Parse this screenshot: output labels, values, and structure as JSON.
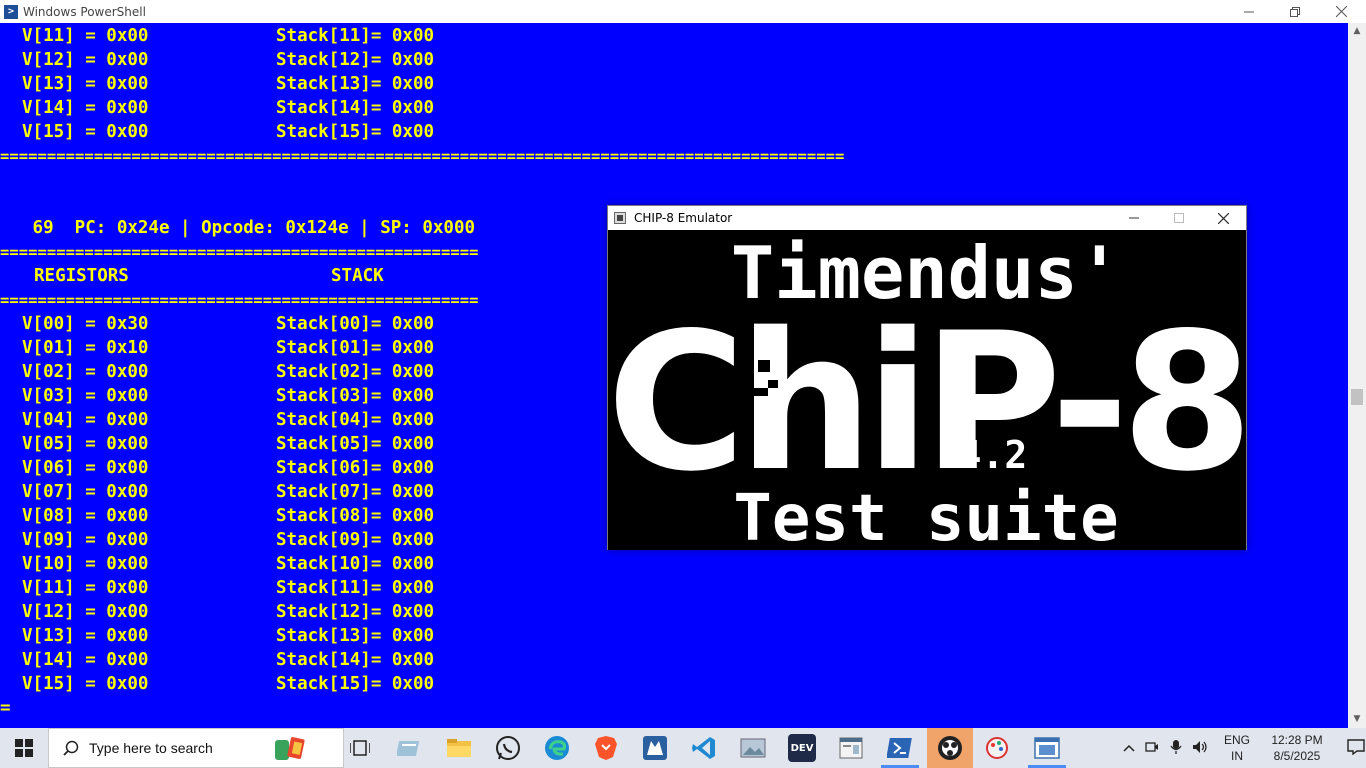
{
  "powershell": {
    "title": "Windows PowerShell",
    "icon": "powershell-icon"
  },
  "console": {
    "top_registers": [
      {
        "reg": "V[11] = 0x00",
        "stack": "Stack[11]= 0x00"
      },
      {
        "reg": "V[12] = 0x00",
        "stack": "Stack[12]= 0x00"
      },
      {
        "reg": "V[13] = 0x00",
        "stack": "Stack[13]= 0x00"
      },
      {
        "reg": "V[14] = 0x00",
        "stack": "Stack[14]= 0x00"
      },
      {
        "reg": "V[15] = 0x00",
        "stack": "Stack[15]= 0x00"
      }
    ],
    "separator_long": "==========================================================================================",
    "separator_short": "===================================================",
    "status_line": " 69  PC: 0x24e | Opcode: 0x124e | SP: 0x000",
    "registers_header": "REGISTORS",
    "stack_header": "STACK",
    "registers": [
      {
        "reg": "V[00] = 0x30",
        "stack": "Stack[00]= 0x00"
      },
      {
        "reg": "V[01] = 0x10",
        "stack": "Stack[01]= 0x00"
      },
      {
        "reg": "V[02] = 0x00",
        "stack": "Stack[02]= 0x00"
      },
      {
        "reg": "V[03] = 0x00",
        "stack": "Stack[03]= 0x00"
      },
      {
        "reg": "V[04] = 0x00",
        "stack": "Stack[04]= 0x00"
      },
      {
        "reg": "V[05] = 0x00",
        "stack": "Stack[05]= 0x00"
      },
      {
        "reg": "V[06] = 0x00",
        "stack": "Stack[06]= 0x00"
      },
      {
        "reg": "V[07] = 0x00",
        "stack": "Stack[07]= 0x00"
      },
      {
        "reg": "V[08] = 0x00",
        "stack": "Stack[08]= 0x00"
      },
      {
        "reg": "V[09] = 0x00",
        "stack": "Stack[09]= 0x00"
      },
      {
        "reg": "V[10] = 0x00",
        "stack": "Stack[10]= 0x00"
      },
      {
        "reg": "V[11] = 0x00",
        "stack": "Stack[11]= 0x00"
      },
      {
        "reg": "V[12] = 0x00",
        "stack": "Stack[12]= 0x00"
      },
      {
        "reg": "V[13] = 0x00",
        "stack": "Stack[13]= 0x00"
      },
      {
        "reg": "V[14] = 0x00",
        "stack": "Stack[14]= 0x00"
      },
      {
        "reg": "V[15] = 0x00",
        "stack": "Stack[15]= 0x00"
      }
    ],
    "last_line": "="
  },
  "emulator": {
    "title": "CHIP-8 Emulator",
    "screen_line1": "Timendus'",
    "screen_line2": "ChiP-8",
    "screen_version": "4.2",
    "screen_line3": "Test suite"
  },
  "taskbar": {
    "search_placeholder": "Type here to search",
    "language_top": "ENG",
    "language_bottom": "IN",
    "time": "12:28 PM",
    "date": "8/5/2025"
  },
  "colors": {
    "console_bg": "#0000ff",
    "console_text": "#ffff00",
    "taskbar_bg": "#e1e6ee",
    "accent": "#4c8df5"
  }
}
